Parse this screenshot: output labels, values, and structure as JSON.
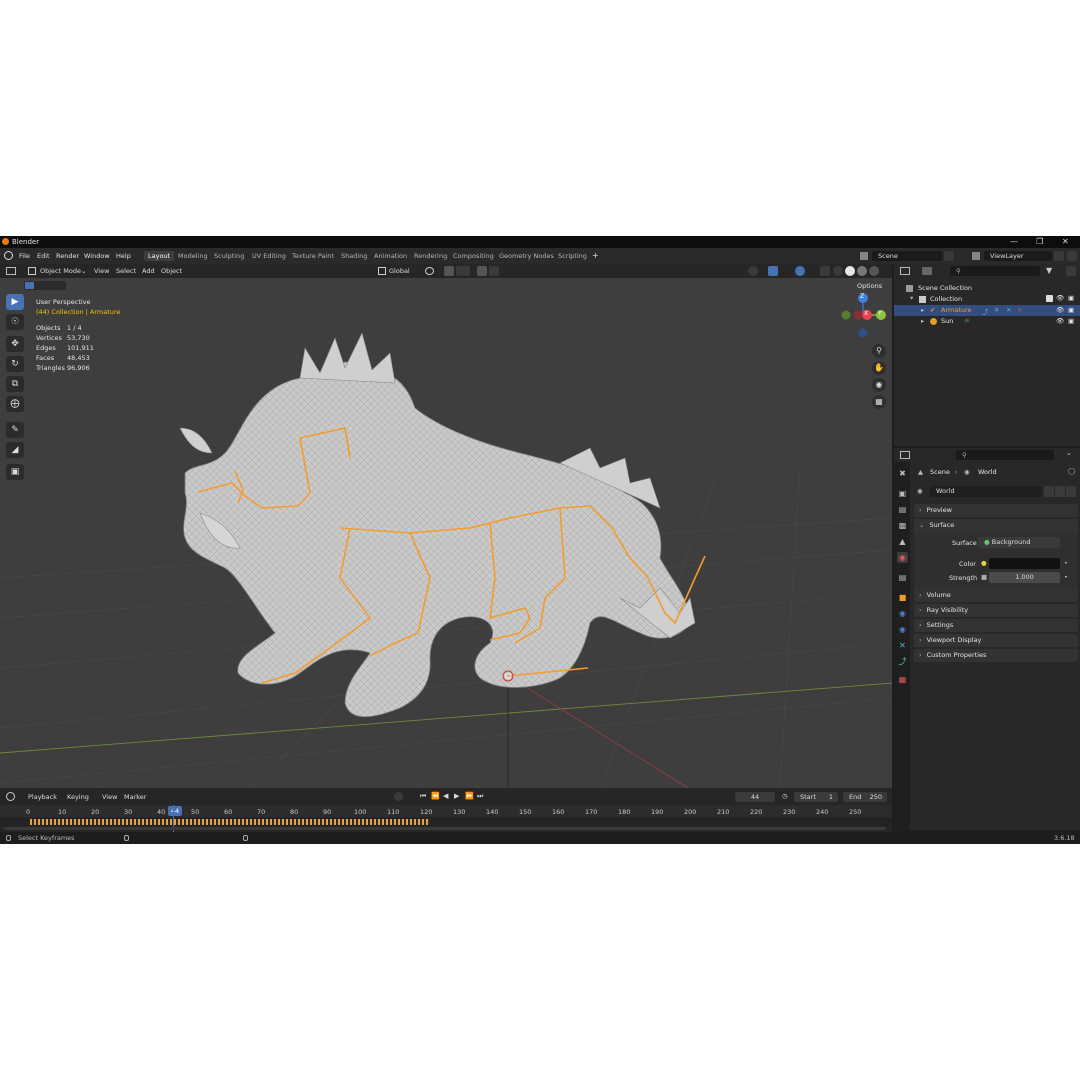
{
  "window": {
    "title": "Blender"
  },
  "menus": [
    "File",
    "Edit",
    "Render",
    "Window",
    "Help"
  ],
  "workspaces": [
    {
      "label": "Layout",
      "active": true
    },
    {
      "label": "Modeling"
    },
    {
      "label": "Sculpting"
    },
    {
      "label": "UV Editing"
    },
    {
      "label": "Texture Paint"
    },
    {
      "label": "Shading"
    },
    {
      "label": "Animation"
    },
    {
      "label": "Rendering"
    },
    {
      "label": "Compositing"
    },
    {
      "label": "Geometry Nodes"
    },
    {
      "label": "Scripting"
    }
  ],
  "add_workspace_label": "+",
  "scene_field": "Scene",
  "view_layer_field": "ViewLayer",
  "viewport_header": {
    "mode": "Object Mode",
    "menus": [
      "View",
      "Select",
      "Add",
      "Object"
    ],
    "transform_orientation": "Global",
    "options": "Options"
  },
  "viewport": {
    "view_name": "User Perspective",
    "collection_info": "(44) Collection | Armature",
    "stats": [
      {
        "label": "Objects",
        "value": "1 / 4"
      },
      {
        "label": "Vertices",
        "value": "53,730"
      },
      {
        "label": "Edges",
        "value": "101,911"
      },
      {
        "label": "Faces",
        "value": "48,453"
      },
      {
        "label": "Triangles",
        "value": "96,906"
      }
    ],
    "gizmo": {
      "z": "Z",
      "x": "X",
      "y": "Y"
    }
  },
  "outliner": {
    "items": [
      {
        "label": "Scene Collection"
      },
      {
        "label": "Collection"
      },
      {
        "label": "Armature",
        "selected": true
      },
      {
        "label": "Sun"
      }
    ]
  },
  "properties": {
    "breadcrumb": [
      "Scene",
      "World"
    ],
    "world_name": "World",
    "panels": {
      "preview": "Preview",
      "surface": "Surface",
      "volume": "Volume",
      "ray_visibility": "Ray Visibility",
      "settings": "Settings",
      "viewport_display": "Viewport Display",
      "custom_properties": "Custom Properties"
    },
    "surface": {
      "label": "Surface",
      "value": "Background"
    },
    "color": {
      "label": "Color"
    },
    "strength": {
      "label": "Strength",
      "value": "1.000"
    }
  },
  "timeline": {
    "menus": [
      "Playback",
      "Keying",
      "View",
      "Marker"
    ],
    "current_frame": "44",
    "start_label": "Start",
    "start": "1",
    "end_label": "End",
    "end": "250",
    "frame_labels": [
      "0",
      "10",
      "20",
      "30",
      "40",
      "44",
      "50",
      "60",
      "70",
      "80",
      "90",
      "100",
      "110",
      "120",
      "130",
      "140",
      "150",
      "160",
      "170",
      "180",
      "190",
      "200",
      "210",
      "220",
      "230",
      "240",
      "250"
    ]
  },
  "statusbar": {
    "hint": "Select Keyframes",
    "version": "3.6.18"
  },
  "colors": {
    "accent": "#4772b3",
    "armature": "#f39c2d",
    "active_text": "#f0c400",
    "gizmo_x": "#e8434f",
    "gizmo_y": "#8bc53f",
    "gizmo_z": "#3f7fe0"
  }
}
